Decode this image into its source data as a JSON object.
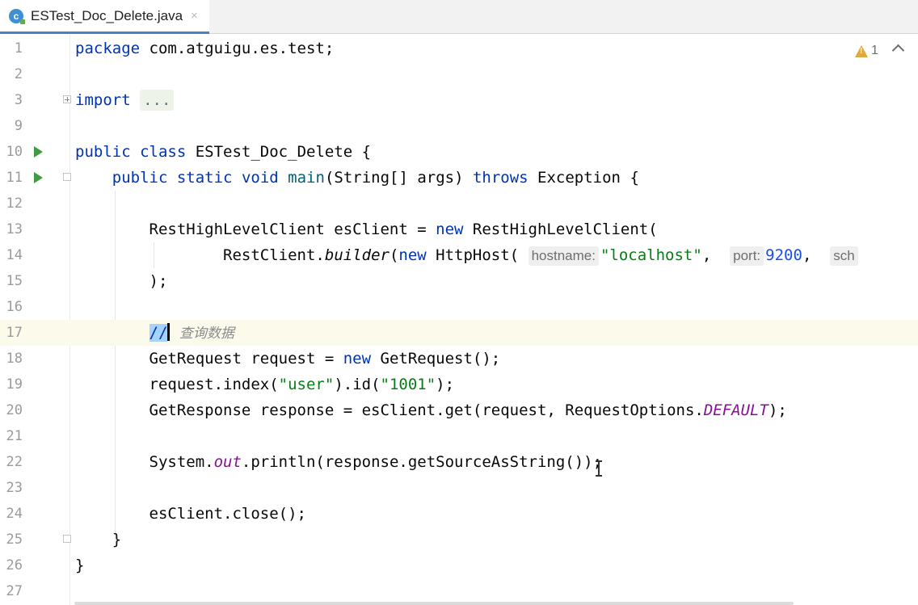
{
  "tab": {
    "icon": "java-class-icon",
    "icon_letter": "c",
    "filename": "ESTest_Doc_Delete.java",
    "close": "×"
  },
  "inspections": {
    "icon": "warning-icon",
    "count": "1"
  },
  "line_numbers": [
    "1",
    "2",
    "3",
    "9",
    "10",
    "11",
    "12",
    "13",
    "14",
    "15",
    "16",
    "17",
    "18",
    "19",
    "20",
    "21",
    "22",
    "23",
    "24",
    "25",
    "26",
    "27"
  ],
  "code": {
    "l1": {
      "kw": "package",
      "rest": " com.atguigu.es.test;"
    },
    "l3": {
      "kw": "import",
      "folded": "..."
    },
    "l10": {
      "kw1": "public",
      "kw2": "class",
      "rest": " ESTest_Doc_Delete {"
    },
    "l11": {
      "kw1": "public",
      "kw2": "static",
      "kw3": "void",
      "fn": "main",
      "args": "(String[] args) ",
      "kw4": "throws",
      "rest": " Exception {"
    },
    "l13": {
      "a": "RestHighLevelClient esClient = ",
      "kw": "new",
      "b": " RestHighLevelClient("
    },
    "l14": {
      "a": "RestClient.",
      "method": "builder",
      "b": "(",
      "kw": "new",
      "c": " HttpHost( ",
      "hint1": "hostname:",
      "str": "\"localhost\"",
      "d": ",  ",
      "hint2": "port:",
      "num": "9200",
      "e": ",  ",
      "hint3": "sch"
    },
    "l15": {
      "a": ");"
    },
    "l17": {
      "sel": "//",
      "comment": "查询数据"
    },
    "l18": {
      "a": "GetRequest request = ",
      "kw": "new",
      "b": " GetRequest();"
    },
    "l19": {
      "a": "request.index(",
      "str1": "\"user\"",
      "b": ").id(",
      "str2": "\"1001\"",
      "c": ");"
    },
    "l20": {
      "a": "GetResponse response = esClient.get(request, RequestOptions.",
      "field": "DEFAULT",
      "b": ");"
    },
    "l22": {
      "a": "System.",
      "field": "out",
      "b": ".println(response.getSourceAsString());"
    },
    "l24": {
      "a": "esClient.close();"
    },
    "l25": {
      "a": "}"
    },
    "l26": {
      "a": "}"
    }
  }
}
